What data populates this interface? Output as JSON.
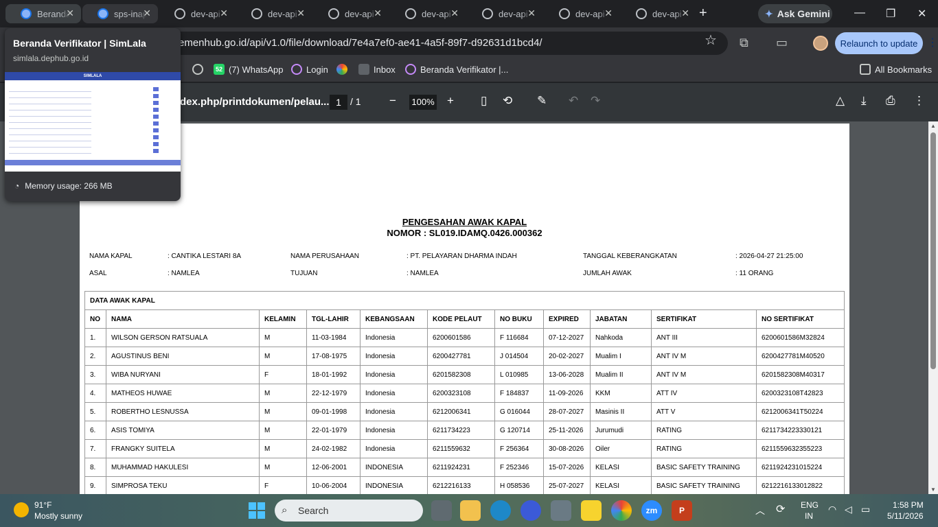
{
  "tabs": [
    {
      "title": "Beranda",
      "favicon": "globe-icon",
      "state": "hover"
    },
    {
      "title": "sps-inaportnet",
      "favicon": "globe-icon",
      "state": "active"
    },
    {
      "title": "dev-api",
      "favicon": "globe-icon",
      "state": "normal"
    },
    {
      "title": "dev-api",
      "favicon": "globe-icon",
      "state": "normal"
    },
    {
      "title": "dev-api",
      "favicon": "globe-icon",
      "state": "normal"
    },
    {
      "title": "dev-api",
      "favicon": "globe-icon",
      "state": "normal"
    },
    {
      "title": "dev-api",
      "favicon": "globe-icon",
      "state": "normal"
    },
    {
      "title": "dev-api",
      "favicon": "globe-icon",
      "state": "normal"
    },
    {
      "title": "dev-api",
      "favicon": "globe-icon",
      "state": "normal"
    }
  ],
  "ask_gemini": "Ask Gemini",
  "address": "emenhub.go.id/api/v1.0/file/download/7e4a7ef0-ae41-4a5f-89f7-d92631d1bcd4/",
  "relaunch": "Relaunch to update",
  "bookmarks": {
    "items": [
      "(7) WhatsApp",
      "Login",
      "Inbox",
      "Beranda Verifikator |..."
    ],
    "whatsapp_badge": "52",
    "all": "All Bookmarks"
  },
  "pdf": {
    "title": "dex.php/printdokumen/pelau...",
    "page": "1",
    "page_sep": "/",
    "total": "1",
    "zoom": "100%"
  },
  "hovercard": {
    "title": "Beranda Verifikator | SimLala",
    "url": "simlala.dephub.go.id",
    "preview_header": "SIMLALA",
    "memory": "Memory usage: 266 MB"
  },
  "doc": {
    "title": "PENGESAHAN AWAK KAPAL",
    "number": "NOMOR : SL019.IDAMQ.0426.000362",
    "meta": [
      {
        "label": "NAMA KAPAL",
        "value": ": CANTIKA LESTARI 8A"
      },
      {
        "label": "NAMA PERUSAHAAN",
        "value": ": PT. PELAYARAN DHARMA INDAH"
      },
      {
        "label": "TANGGAL KEBERANGKATAN",
        "value": ": 2026-04-27 21:25:00"
      },
      {
        "label": "ASAL",
        "value": ": NAMLEA"
      },
      {
        "label": "TUJUAN",
        "value": ": NAMLEA"
      },
      {
        "label": "JUMLAH AWAK",
        "value": ": 11 ORANG"
      }
    ],
    "table_caption": "DATA AWAK KAPAL",
    "columns": [
      "NO",
      "NAMA",
      "KELAMIN",
      "TGL-LAHIR",
      "KEBANGSAAN",
      "KODE PELAUT",
      "NO BUKU",
      "EXPIRED",
      "JABATAN",
      "SERTIFIKAT",
      "NO SERTIFIKAT"
    ],
    "rows": [
      [
        "1.",
        "WILSON GERSON RATSUALA",
        "M",
        "11-03-1984",
        "Indonesia",
        "6200601586",
        "F 116684",
        "07-12-2027",
        "Nahkoda",
        "ANT III",
        "6200601586M32824"
      ],
      [
        "2.",
        "AGUSTINUS BENI",
        "M",
        "17-08-1975",
        "Indonesia",
        "6200427781",
        "J 014504",
        "20-02-2027",
        "Mualim I",
        "ANT IV M",
        "6200427781M40520"
      ],
      [
        "3.",
        "WIBA NURYANI",
        "F",
        "18-01-1992",
        "Indonesia",
        "6201582308",
        "L 010985",
        "13-06-2028",
        "Mualim II",
        "ANT IV M",
        "6201582308M40317"
      ],
      [
        "4.",
        "MATHEOS HUWAE",
        "M",
        "22-12-1979",
        "Indonesia",
        "6200323108",
        "F 184837",
        "11-09-2026",
        "KKM",
        "ATT IV",
        "6200323108T42823"
      ],
      [
        "5.",
        "ROBERTHO LESNUSSA",
        "M",
        "09-01-1998",
        "Indonesia",
        "6212006341",
        "G 016044",
        "28-07-2027",
        "Masinis II",
        "ATT V",
        "6212006341T50224"
      ],
      [
        "6.",
        "ASIS TOMIYA",
        "M",
        "22-01-1979",
        "Indonesia",
        "6211734223",
        "G 120714",
        "25-11-2026",
        "Jurumudi",
        "RATING",
        "621173422333012​1"
      ],
      [
        "7.",
        "FRANGKY SUITELA",
        "M",
        "24-02-1982",
        "Indonesia",
        "6211559632",
        "F 256364",
        "30-08-2026",
        "Oiler",
        "RATING",
        "6211559632355223"
      ],
      [
        "8.",
        "MUHAMMAD HAKULESI",
        "M",
        "12-06-2001",
        "INDONESIA",
        "6211924231",
        "F 252346",
        "15-07-2026",
        "KELASI",
        "BASIC SAFETY TRAINING",
        "6211924231015224"
      ],
      [
        "9.",
        "SIMPROSA TEKU",
        "F",
        "10-06-2004",
        "INDONESIA",
        "6212216133",
        "H 058536",
        "25-07-2027",
        "KELASI",
        "BASIC SAFETY TRAINING",
        "6212216133012822"
      ]
    ]
  },
  "taskbar": {
    "temp": "91°F",
    "condition": "Mostly sunny",
    "search": "Search",
    "lang1": "ENG",
    "lang2": "IN",
    "time": "1:58 PM",
    "date": "5/11/2026"
  }
}
